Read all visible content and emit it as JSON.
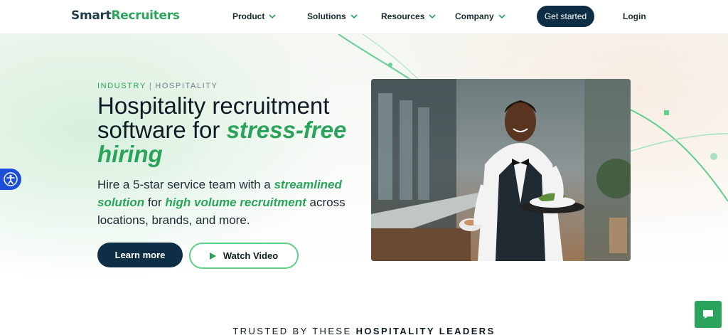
{
  "nav": {
    "logo_part1": "Smart",
    "logo_part2": "Recruiters",
    "items": [
      {
        "label": "Product"
      },
      {
        "label": "Solutions"
      },
      {
        "label": "Resources"
      },
      {
        "label": "Company"
      }
    ],
    "cta_label": "Get started",
    "login_label": "Login"
  },
  "hero": {
    "eyebrow_1": "INDUSTRY",
    "eyebrow_sep": "|",
    "eyebrow_2": "HOSPITALITY",
    "headline_plain": "Hospitality recruitment software for ",
    "headline_em": "stress-free hiring",
    "sub_1": "Hire a 5-star service team with a ",
    "sub_em1": "streamlined solution",
    "sub_2": " for ",
    "sub_em2": "high volume recruitment",
    "sub_3": " across locations, brands, and more.",
    "learn_more_label": "Learn more",
    "watch_video_label": "Watch Video"
  },
  "trusted": {
    "plain": "TRUSTED BY THESE ",
    "bold": "HOSPITALITY LEADERS"
  },
  "colors": {
    "brand_green": "#2aa45a",
    "navy": "#0d2e44",
    "accessibility_blue": "#1d4ed8"
  },
  "icons": {
    "nav_chevron": "chevron-down-icon",
    "play": "play-icon",
    "accessibility": "accessibility-icon",
    "chat": "chat-bubble-icon"
  }
}
